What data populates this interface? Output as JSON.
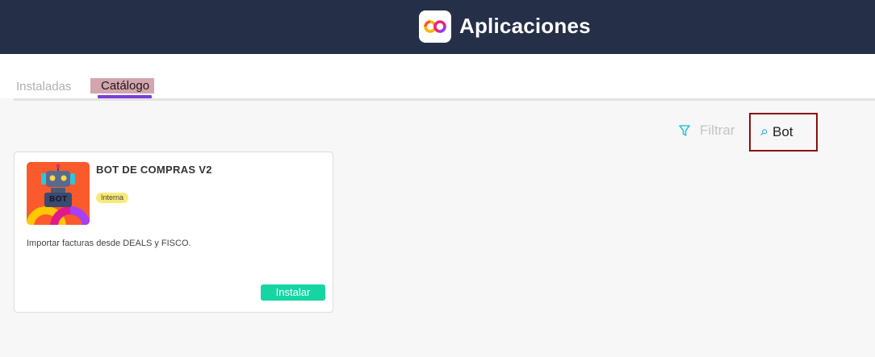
{
  "header": {
    "title": "Aplicaciones",
    "logo_icon": "infinity-logo-icon",
    "background": "#252f48"
  },
  "tabs": [
    {
      "label": "Instaladas",
      "active": false
    },
    {
      "label": "Catálogo",
      "active": true
    }
  ],
  "toolbar": {
    "filter_label": "Filtrar",
    "filter_icon": "filter-funnel-icon",
    "search_icon": "search-icon",
    "search_value": "Bot"
  },
  "apps": [
    {
      "name": "BOT DE COMPRAS V2",
      "badge": "Interna",
      "description": "Importar facturas desde DEALS y FISCO.",
      "install_label": "Instalar",
      "thumbnail_text": "BOT",
      "thumbnail_icon": "robot-icon"
    }
  ],
  "colors": {
    "accent_tab": "#7a3fd6",
    "install_button": "#15d6a3",
    "badge_bg": "#f8ea78",
    "search_border": "#8a1010"
  }
}
